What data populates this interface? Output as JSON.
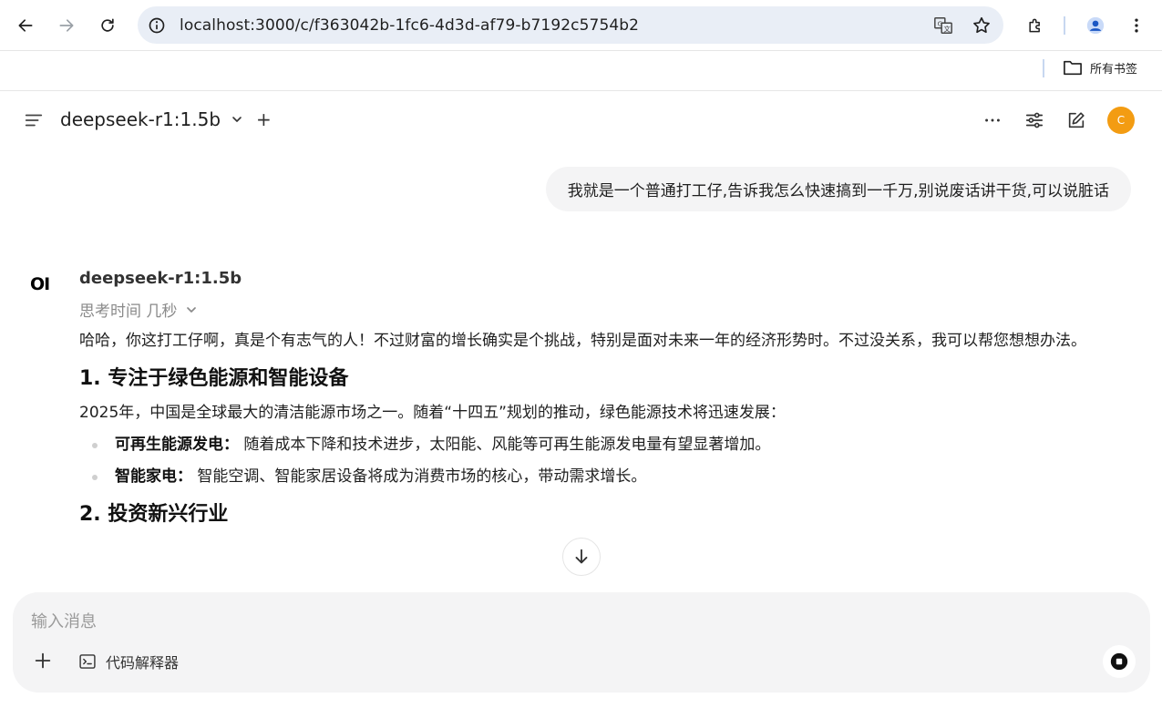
{
  "browser": {
    "url": "localhost:3000/c/f363042b-1fc6-4d3d-af79-b7192c5754b2",
    "bookmarks_folder": "所有书签"
  },
  "header": {
    "model_name": "deepseek-r1:1.5b",
    "add_label": "+",
    "avatar_initial": "C",
    "avatar_color": "#f39c12"
  },
  "chat": {
    "user_message": "我就是一个普通打工仔,告诉我怎么快速搞到一千万,别说废话讲干货,可以说脏话",
    "assistant": {
      "logo": "OI",
      "name": "deepseek-r1:1.5b",
      "thinking_label": "思考时间 几秒",
      "intro": "哈哈，你这打工仔啊，真是个有志气的人！不过财富的增长确实是个挑战，特别是面对未来一年的经济形势时。不过没关系，我可以帮您想想办法。",
      "section1_title": "1. 专注于绿色能源和智能设备",
      "section1_text": "2025年，中国是全球最大的清洁能源市场之一。随着“十四五”规划的推动，绿色能源技术将迅速发展：",
      "bullets": [
        {
          "label": "可再生能源发电：",
          "text": "随着成本下降和技术进步，太阳能、风能等可再生能源发电量有望显著增加。"
        },
        {
          "label": "智能家电：",
          "text": "智能空调、智能家居设备将成为消费市场的核心，带动需求增长。"
        }
      ],
      "section2_title": "2. 投资新兴行业"
    }
  },
  "composer": {
    "placeholder": "输入消息",
    "code_interpreter_label": "代码解释器"
  }
}
